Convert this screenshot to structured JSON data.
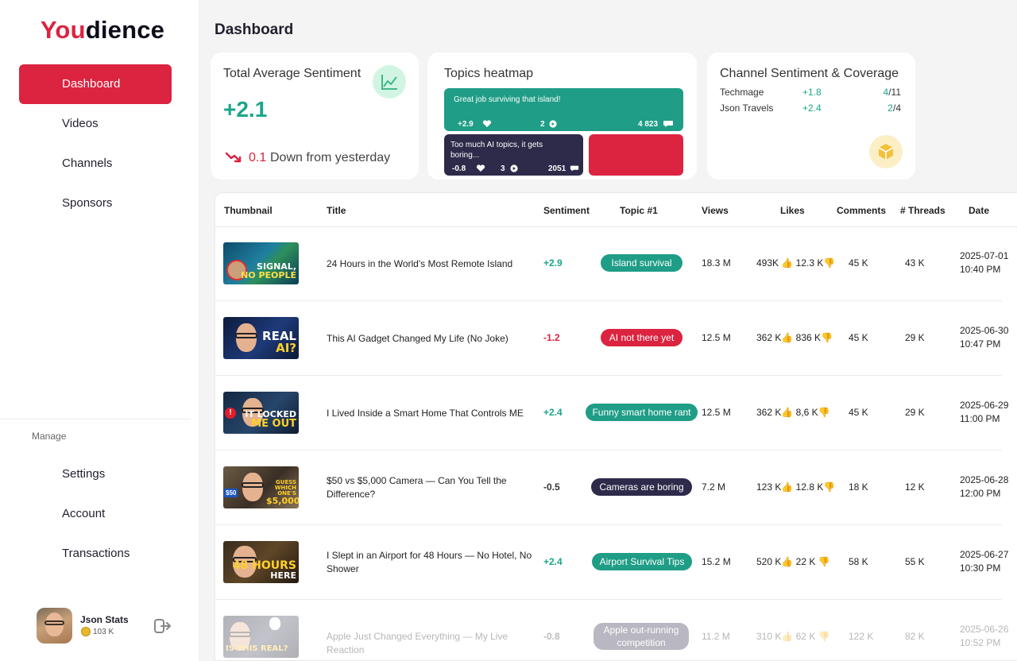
{
  "sidebar": {
    "logo_red": "You",
    "logo_dark": "dience",
    "nav": [
      {
        "label": "Dashboard"
      },
      {
        "label": "Videos"
      },
      {
        "label": "Channels"
      },
      {
        "label": "Sponsors"
      }
    ],
    "manage_label": "Manage",
    "manage_nav": [
      {
        "label": "Settings"
      },
      {
        "label": "Account"
      },
      {
        "label": "Transactions"
      }
    ],
    "user": {
      "name": "Json Stats",
      "subscribers": "103 K"
    }
  },
  "page_title": "Dashboard",
  "sentiment_card": {
    "title": "Total Average Sentiment",
    "value": "+2.1",
    "change_value": "0.1",
    "change_text": "Down from yesterday"
  },
  "heatmap_card": {
    "title": "Topics heatmap",
    "tiles": [
      {
        "text": "Great job surviving that island!",
        "sentiment": "+2.9",
        "videos": "2",
        "comments": "4 823",
        "color": "#1f9d86"
      },
      {
        "text": "Too much AI topics, it gets boring...",
        "sentiment": "-0.8",
        "videos": "3",
        "comments": "2051",
        "color": "#2d2a4a"
      },
      {
        "text": "",
        "color": "#dc2340"
      }
    ]
  },
  "channel_card": {
    "title": "Channel Sentiment & Coverage",
    "channels": [
      {
        "name": "Techmage",
        "sentiment": "+1.8",
        "covered": "4",
        "total": "/11"
      },
      {
        "name": "Json Travels",
        "sentiment": "+2.4",
        "covered": "2",
        "total": "/4"
      }
    ]
  },
  "table": {
    "headers": {
      "thumbnail": "Thumbnail",
      "title": "Title",
      "sentiment": "Sentiment",
      "topic": "Topic #1",
      "views": "Views",
      "likes": "Likes",
      "comments": "Comments",
      "threads": "# Threads",
      "date": "Date"
    },
    "rows": [
      {
        "thumb_line1": "SIGNAL,",
        "thumb_line2": "NO PEOPLE",
        "title": "24 Hours in the World's Most Remote Island",
        "sentiment": "+2.9",
        "topic": "Island survival",
        "topic_color": "#1f9d86",
        "views": "18.3 M",
        "likes": "493K",
        "dislikes": "12.3 K",
        "comments": "45 K",
        "threads": "43 K",
        "date": "2025-07-01",
        "time": "10:40 PM"
      },
      {
        "thumb_line1": "REAL",
        "thumb_line2": "AI?",
        "title": "This AI Gadget Changed My Life (No Joke)",
        "sentiment": "-1.2",
        "topic": "AI not there yet",
        "topic_color": "#dc2340",
        "views": "12.5 M",
        "likes": "362 K",
        "dislikes": "836 K",
        "comments": "45 K",
        "threads": "29 K",
        "date": "2025-06-30",
        "time": "10:47 PM"
      },
      {
        "thumb_line1": "IT LOCKED",
        "thumb_line2": "ME OUT",
        "title": "I Lived Inside a Smart Home That Controls ME",
        "sentiment": "+2.4",
        "topic": "Funny smart home rant",
        "topic_color": "#1f9d86",
        "views": "12.5 M",
        "likes": "362 K",
        "dislikes": "8,6 K",
        "comments": "45 K",
        "threads": "29 K",
        "date": "2025-06-29",
        "time": "11:00 PM"
      },
      {
        "thumb_line1": "GUESS WHICH ONE'S",
        "thumb_line2": "$5,000",
        "thumb_tag": "$50",
        "title": "$50 vs $5,000 Camera — Can You Tell the Difference?",
        "sentiment": "-0.5",
        "topic": "Cameras are boring",
        "topic_color": "#2d2a4a",
        "views": "7.2 M",
        "likes": "123 K",
        "dislikes": "12.8 K",
        "comments": "18 K",
        "threads": "12 K",
        "date": "2025-06-28",
        "time": "12:00 PM"
      },
      {
        "thumb_line1": "48 HOURS",
        "thumb_line2": "HERE",
        "title": "I Slept in an Airport for 48 Hours — No Hotel, No Shower",
        "sentiment": "+2.4",
        "topic": "Airport Survival Tips",
        "topic_color": "#1f9d86",
        "views": "15.2 M",
        "likes": "520 K",
        "dislikes": "22 K",
        "comments": "58 K",
        "threads": "55 K",
        "date": "2025-06-27",
        "time": "10:30 PM"
      },
      {
        "thumb_line1": "IS THIS REAL?",
        "thumb_line2": "",
        "title": "Apple Just Changed Everything — My Live Reaction",
        "sentiment": "-0.8",
        "topic": "Apple out-running competition",
        "topic_color": "#2d2a4a",
        "views": "11.2 M",
        "likes": "310 K",
        "dislikes": "62 K",
        "comments": "122 K",
        "threads": "82 K",
        "date": "2025-06-26",
        "time": "10:52 PM"
      }
    ]
  },
  "colors": {
    "brand": "#dc2340",
    "positive": "#1aa68b",
    "dark": "#2d2a4a"
  }
}
